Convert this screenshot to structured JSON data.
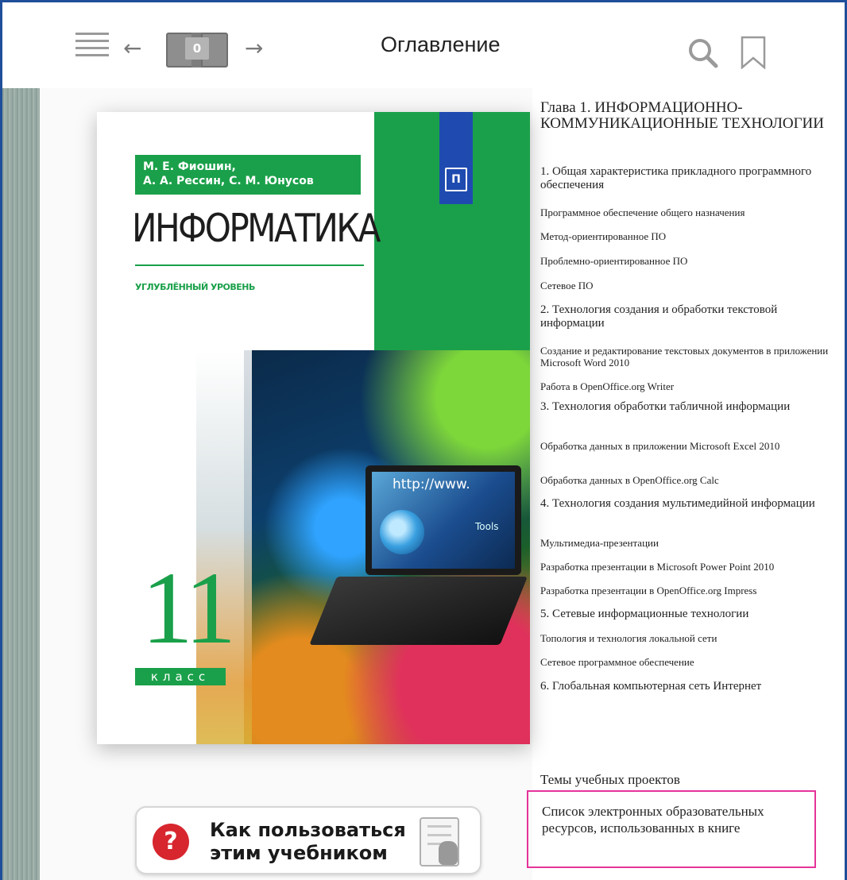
{
  "toolbar": {
    "bookmarks_count": "0",
    "title": "Оглавление"
  },
  "cover": {
    "authors_line1": "М. Е. Фиошин,",
    "authors_line2": "А. А. Рессин, С. М. Юнусов",
    "title": "ИНФОРМАТИКА",
    "level": "УГЛУБЛЁННЫЙ УРОВЕНЬ",
    "grade": "11",
    "grade_label": "класс",
    "screen_url": "http://www.",
    "screen_tools": "Tools"
  },
  "help_button": {
    "line1": "Как пользоваться",
    "line2": "этим учебником"
  },
  "toc": {
    "items": [
      {
        "text": "Глава 1. ИНФОРМАЦИОННО-КОММУНИКАЦИОННЫЕ ТЕХНОЛОГИИ",
        "level": "chapter"
      },
      {
        "text": "1. Общая характеристика прикладного программного обеспечения",
        "level": "section"
      },
      {
        "text": "Программное обеспечение общего назначения",
        "level": "sub"
      },
      {
        "text": "Метод-ориентированное ПО",
        "level": "sub"
      },
      {
        "text": "Проблемно-ориентированное ПО",
        "level": "sub"
      },
      {
        "text": "Сетевое ПО",
        "level": "sub"
      },
      {
        "text": "2. Технология создания и обработки текстовой информации",
        "level": "section"
      },
      {
        "text": "Создание и редактирование текстовых документов в приложении Microsoft Word 2010",
        "level": "sub"
      },
      {
        "text": "Работа в OpenOffice.org Writer",
        "level": "sub"
      },
      {
        "text": "3. Технология обработки табличной информации",
        "level": "section"
      },
      {
        "text": "Обработка данных в приложении Microsoft Excel 2010",
        "level": "sub"
      },
      {
        "text": "Обработка данных в OpenOffice.org Calc",
        "level": "sub"
      },
      {
        "text": "4. Технология создания мультимедийной информации",
        "level": "section"
      },
      {
        "text": "Мультимедиа-презентации",
        "level": "sub"
      },
      {
        "text": "Разработка презентации в Microsoft Power Point 2010",
        "level": "sub"
      },
      {
        "text": "Разработка презентации в OpenOffice.org Impress",
        "level": "sub"
      },
      {
        "text": "5. Сетевые информационные технологии",
        "level": "section"
      },
      {
        "text": "Топология и технология локальной сети",
        "level": "sub"
      },
      {
        "text": "Сетевое программное обеспечение",
        "level": "sub"
      },
      {
        "text": "6. Глобальная компьютерная сеть Интернет",
        "level": "section"
      },
      {
        "text": "Темы учебных проектов",
        "level": "projects"
      },
      {
        "text": "Список электронных образовательных ресурсов, использованных в книге",
        "level": "resources"
      }
    ]
  },
  "colors": {
    "frame": "#1f4e9a",
    "cover_green": "#1aa04a",
    "publisher_blue": "#1f4bb0",
    "highlight": "#e6339a",
    "help_red": "#d7262e"
  },
  "icons": [
    "menu-icon",
    "arrow-left-icon",
    "book-counter-icon",
    "arrow-right-icon",
    "search-icon",
    "bookmark-icon",
    "question-icon",
    "tap-hand-icon"
  ]
}
